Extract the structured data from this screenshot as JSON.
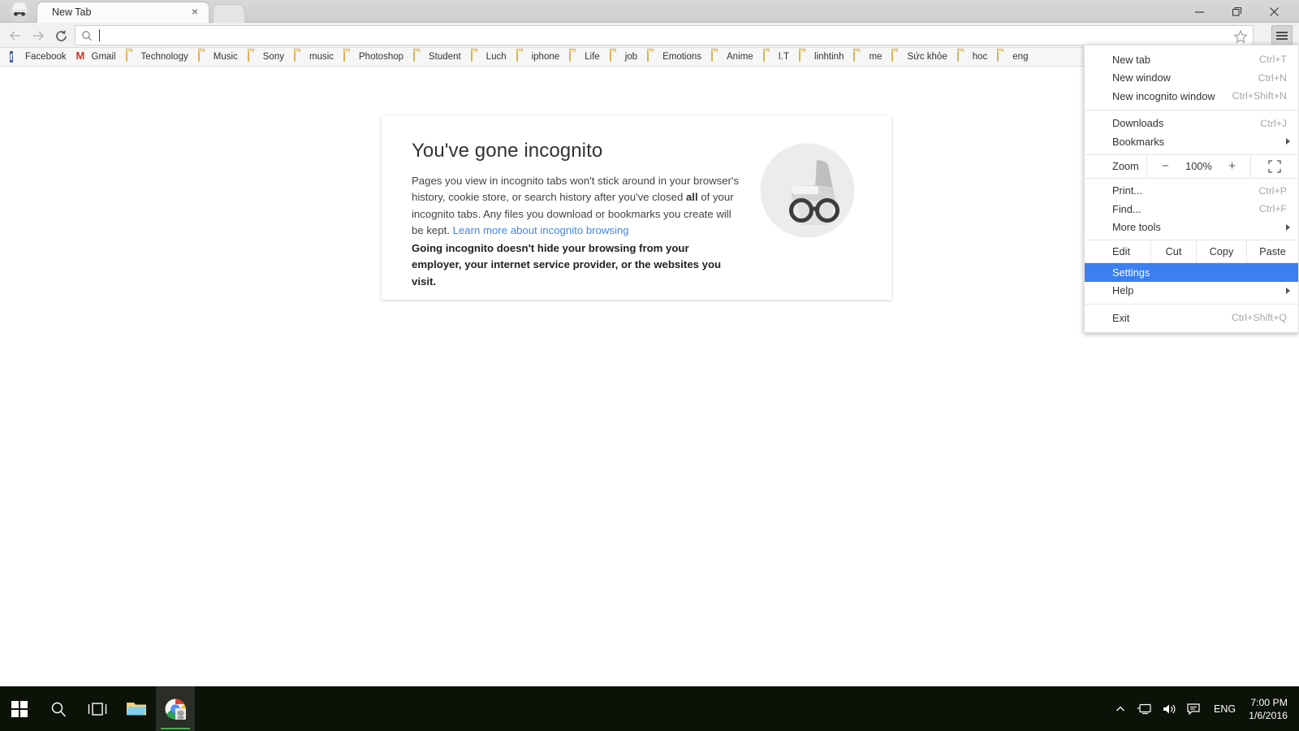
{
  "window": {
    "tab_title": "New Tab",
    "controls": {
      "minimize": "minimize-icon",
      "maximize": "restore-icon",
      "close": "close-icon"
    },
    "avatar_icon": "incognito-avatar-icon",
    "new_tab_button": "new-tab-button",
    "tab_close": "×"
  },
  "toolbar": {
    "back_icon": "back-arrow-icon",
    "forward_icon": "forward-arrow-icon",
    "reload_icon": "reload-icon",
    "search_icon": "search-icon",
    "omnibox_value": "",
    "omnibox_placeholder": "",
    "star_icon": "star-icon",
    "menu_icon": "hamburger-menu-icon"
  },
  "bookmarks": [
    {
      "label": "Facebook",
      "icon": "facebook-icon"
    },
    {
      "label": "Gmail",
      "icon": "gmail-icon"
    },
    {
      "label": "Technology",
      "icon": "folder-icon"
    },
    {
      "label": "Music",
      "icon": "folder-icon"
    },
    {
      "label": "Sony",
      "icon": "folder-icon"
    },
    {
      "label": "music",
      "icon": "folder-icon"
    },
    {
      "label": "Photoshop",
      "icon": "folder-icon"
    },
    {
      "label": "Student",
      "icon": "folder-icon"
    },
    {
      "label": "Luch",
      "icon": "folder-icon"
    },
    {
      "label": "iphone",
      "icon": "folder-icon"
    },
    {
      "label": "Life",
      "icon": "folder-icon"
    },
    {
      "label": "job",
      "icon": "folder-icon"
    },
    {
      "label": "Emotions",
      "icon": "folder-icon"
    },
    {
      "label": "Anime",
      "icon": "folder-icon"
    },
    {
      "label": "I.T",
      "icon": "folder-icon"
    },
    {
      "label": "linhtinh",
      "icon": "folder-icon"
    },
    {
      "label": "me",
      "icon": "folder-icon"
    },
    {
      "label": "Sức khỏe",
      "icon": "folder-icon"
    },
    {
      "label": "hoc",
      "icon": "folder-icon"
    },
    {
      "label": "eng",
      "icon": "folder-icon"
    }
  ],
  "incognito_card": {
    "title": "You've gone incognito",
    "body_part1": "Pages you view in incognito tabs won't stick around in your browser's history, cookie store, or search history after you've closed ",
    "body_bold": "all",
    "body_part2": " of your incognito tabs. Any files you download or bookmarks you create will be kept. ",
    "link_text": "Learn more about incognito browsing",
    "warning": "Going incognito doesn't hide your browsing from your employer, your internet service provider, or the websites you visit.",
    "illustration": "incognito-spy-illustration"
  },
  "chrome_menu": {
    "items": [
      {
        "label": "New tab",
        "accel": "Ctrl+T",
        "arrow": false,
        "selected": false
      },
      {
        "label": "New window",
        "accel": "Ctrl+N",
        "arrow": false,
        "selected": false
      },
      {
        "label": "New incognito window",
        "accel": "Ctrl+Shift+N",
        "arrow": false,
        "selected": false
      },
      {
        "label": "Downloads",
        "accel": "Ctrl+J",
        "arrow": false,
        "selected": false
      },
      {
        "label": "Bookmarks",
        "accel": "",
        "arrow": true,
        "selected": false
      },
      {
        "label": "Print...",
        "accel": "Ctrl+P",
        "arrow": false,
        "selected": false
      },
      {
        "label": "Find...",
        "accel": "Ctrl+F",
        "arrow": false,
        "selected": false
      },
      {
        "label": "More tools",
        "accel": "",
        "arrow": true,
        "selected": false
      },
      {
        "label": "Settings",
        "accel": "",
        "arrow": false,
        "selected": true
      },
      {
        "label": "Help",
        "accel": "",
        "arrow": true,
        "selected": false
      },
      {
        "label": "Exit",
        "accel": "Ctrl+Shift+Q",
        "arrow": false,
        "selected": false
      }
    ],
    "zoom": {
      "label": "Zoom",
      "minus": "−",
      "value": "100%",
      "plus": "+",
      "fullscreen_icon": "fullscreen-icon"
    },
    "edit": {
      "label": "Edit",
      "cut": "Cut",
      "copy": "Copy",
      "paste": "Paste"
    },
    "highlight_color": "#3b7ff0"
  },
  "taskbar": {
    "start_icon": "windows-start-icon",
    "search_icon": "taskbar-search-icon",
    "taskview_icon": "task-view-icon",
    "explorer_icon": "file-explorer-icon",
    "chrome_icon": "chrome-incognito-icon",
    "tray": {
      "chevron": "show-hidden-icons-chevron",
      "network_icon": "network-icon",
      "volume_icon": "volume-icon",
      "action_center_icon": "action-center-icon",
      "language": "ENG",
      "time": "7:00 PM",
      "date": "1/6/2016"
    }
  }
}
